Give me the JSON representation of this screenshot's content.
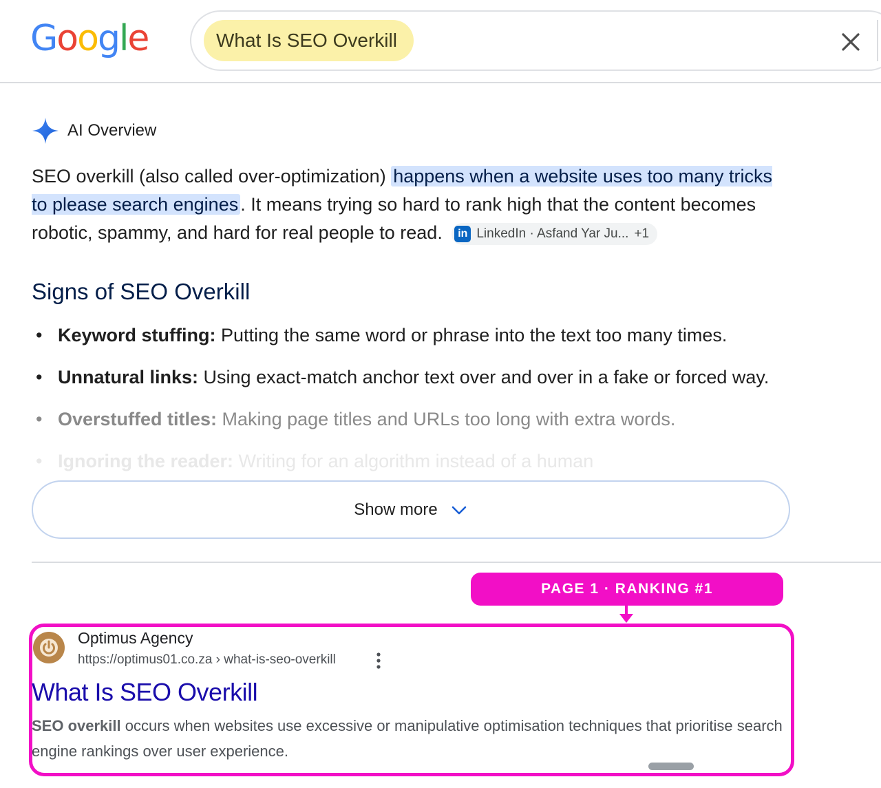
{
  "header": {
    "logo_letters": [
      {
        "char": "G",
        "color": "#4285F4"
      },
      {
        "char": "o",
        "color": "#EA4335"
      },
      {
        "char": "o",
        "color": "#FBBC05"
      },
      {
        "char": "g",
        "color": "#4285F4"
      },
      {
        "char": "l",
        "color": "#34A853"
      },
      {
        "char": "e",
        "color": "#EA4335"
      }
    ],
    "search_query": "What Is SEO Overkill",
    "clear_icon": "close-icon"
  },
  "ai_overview": {
    "icon": "sparkle-icon",
    "title": "AI Overview",
    "intro_before": "SEO overkill (also called over-optimization) ",
    "intro_highlight": "happens when a website uses too many tricks to please search engines",
    "intro_after": ". It means trying so hard to rank high that the content becomes robotic, spammy, and hard for real people to read.",
    "source_chip": {
      "icon": "linkedin-icon",
      "label": "LinkedIn · Asfand Yar Ju...",
      "extra": "+1"
    },
    "signs_heading": "Signs of SEO Overkill",
    "bullets": [
      {
        "term": "Keyword stuffing:",
        "text": " Putting the same word or phrase into the text too many times."
      },
      {
        "term": "Unnatural links:",
        "text": " Using exact-match anchor text over and over in a fake or forced way."
      },
      {
        "term": "Overstuffed titles:",
        "text": " Making page titles and URLs too long with extra words."
      },
      {
        "term": "Ignoring the reader:",
        "text": " Writing for an algorithm instead of a human"
      }
    ],
    "show_more_label": "Show more",
    "show_more_icon": "chevron-down-icon"
  },
  "annotation": {
    "badge_text": "PAGE 1  ·  RANKING #1",
    "color": "#F20FC6"
  },
  "result": {
    "favicon": "power-icon",
    "site_name": "Optimus Agency",
    "url": "https://optimus01.co.za › what-is-seo-overkill",
    "menu_icon": "more-vertical-icon",
    "title": "What Is SEO Overkill",
    "snippet_bold": "SEO overkill",
    "snippet_text": " occurs when websites use excessive or manipulative optimisation techniques that prioritise search engine rankings over user experience."
  }
}
